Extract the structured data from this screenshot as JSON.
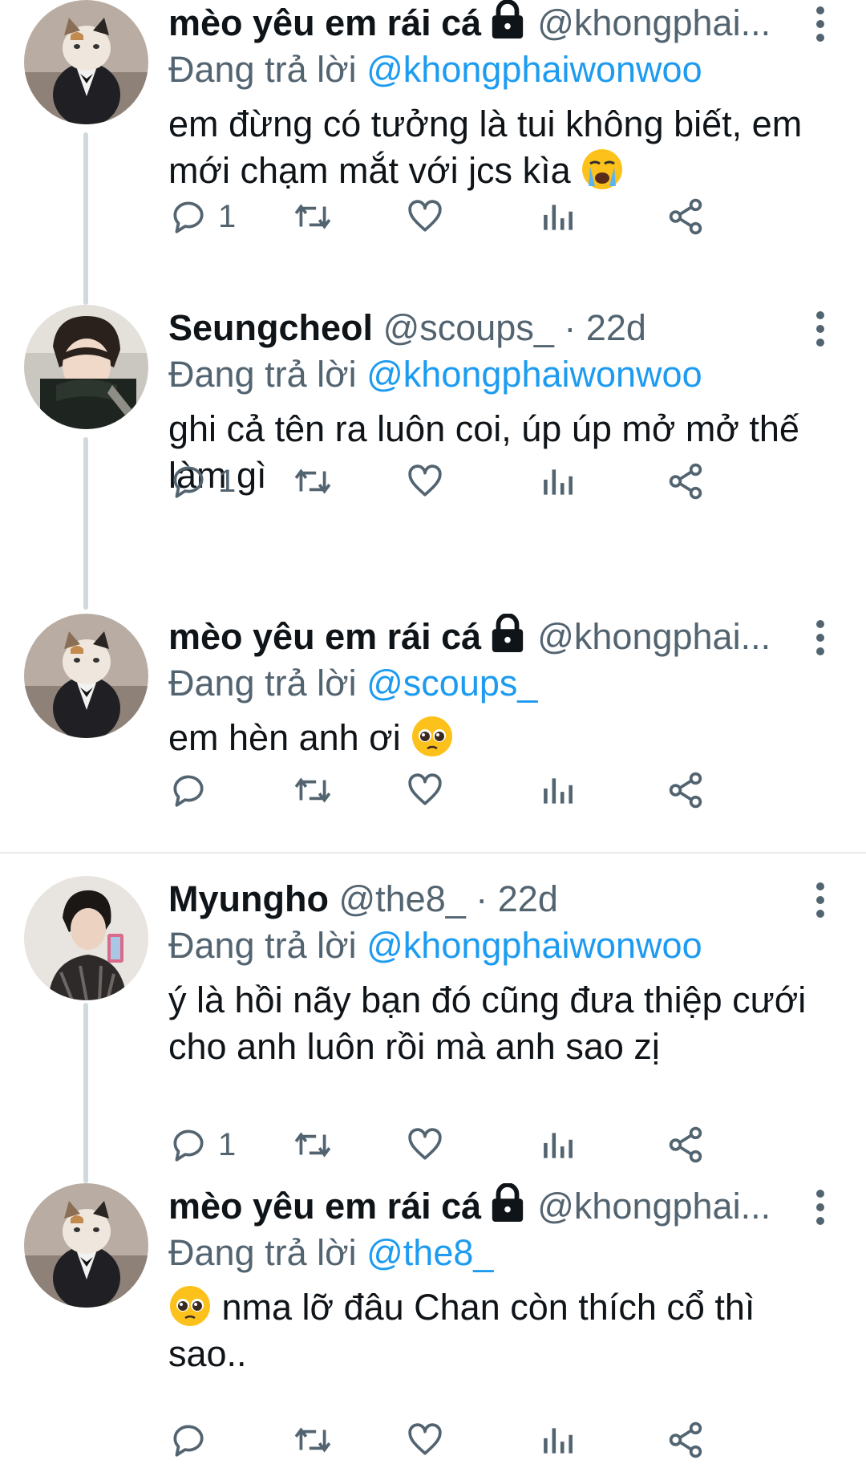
{
  "colors": {
    "accent": "#1d9bf0",
    "secondary_text": "#536471",
    "thread_line": "#cfd9de"
  },
  "reply_prefix": "Đang trả lời",
  "tweets": [
    {
      "name": "mèo yêu em rái cá",
      "locked": true,
      "handle": "@khongphai...",
      "time": "",
      "avatar": "cat-in-suit",
      "reply_to": "@khongphaiwonwoo",
      "text": "em đừng có tưởng là tui không biết, em mới chạm mắt với jcs kìa",
      "emoji": "crying-face-emoji",
      "reply_count": "1"
    },
    {
      "name": "Seungcheol",
      "locked": false,
      "handle": "@scoups_",
      "time": "· 22d",
      "avatar": "person-in-car",
      "reply_to": "@khongphaiwonwoo",
      "text": "ghi cả tên ra luôn coi, úp úp mở mở thế làm gì",
      "emoji": "",
      "reply_count": "1"
    },
    {
      "name": "mèo yêu em rái cá",
      "locked": true,
      "handle": "@khongphai...",
      "time": "",
      "avatar": "cat-in-suit",
      "reply_to": "@scoups_",
      "text": "em hèn anh ơi",
      "emoji": "pleading-face-emoji",
      "reply_count": ""
    },
    {
      "name": "Myungho",
      "locked": false,
      "handle": "@the8_",
      "time": "· 22d",
      "avatar": "person-mirror-selfie",
      "reply_to": "@khongphaiwonwoo",
      "text": "ý là hồi nãy bạn đó cũng đưa thiệp cưới cho anh luôn rồi mà anh sao zị",
      "emoji": "",
      "reply_count": "1"
    },
    {
      "name": "mèo yêu em rái cá",
      "locked": true,
      "handle": "@khongphai...",
      "time": "",
      "avatar": "cat-in-suit",
      "reply_to": "@the8_",
      "text": "nma lỡ đâu Chan còn thích cổ thì sao..",
      "emoji": "pleading-face-emoji",
      "reply_count": ""
    }
  ]
}
